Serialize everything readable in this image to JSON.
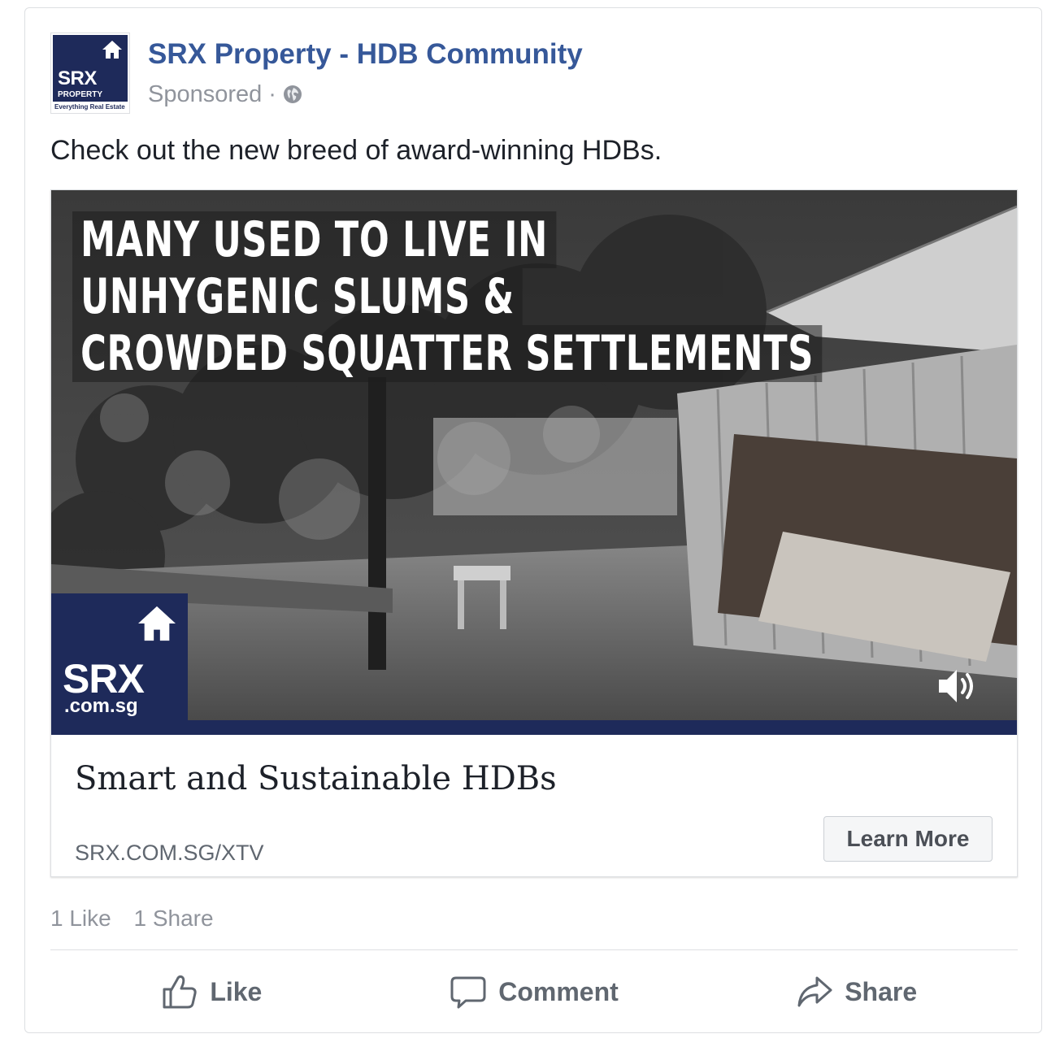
{
  "post": {
    "page_name": "SRX Property - HDB Community",
    "sponsored": "Sponsored",
    "separator": "·",
    "text": "Check out the new breed of award-winning HDBs."
  },
  "avatar": {
    "brand": "SRX",
    "sub": "PROPERTY",
    "tagline": "Everything Real Estate"
  },
  "video": {
    "headline": [
      "MANY USED TO LIVE IN",
      "UNHYGENIC SLUMS &",
      "CROWDED SQUATTER SETTLEMENTS"
    ],
    "logo_brand": "SRX",
    "logo_domain": ".com.sg"
  },
  "link": {
    "title": "Smart and Sustainable HDBs",
    "url": "SRX.COM.SG/XTV",
    "cta": "Learn More"
  },
  "stats": {
    "likes": "1 Like",
    "shares": "1 Share"
  },
  "actions": {
    "like": "Like",
    "comment": "Comment",
    "share": "Share"
  },
  "colors": {
    "link_blue": "#365899",
    "brand_navy": "#1e2a5a",
    "meta_gray": "#90949c"
  },
  "icons": [
    "globe-icon",
    "house-icon",
    "sound-icon",
    "thumbs-up-icon",
    "comment-icon",
    "share-arrow-icon"
  ]
}
